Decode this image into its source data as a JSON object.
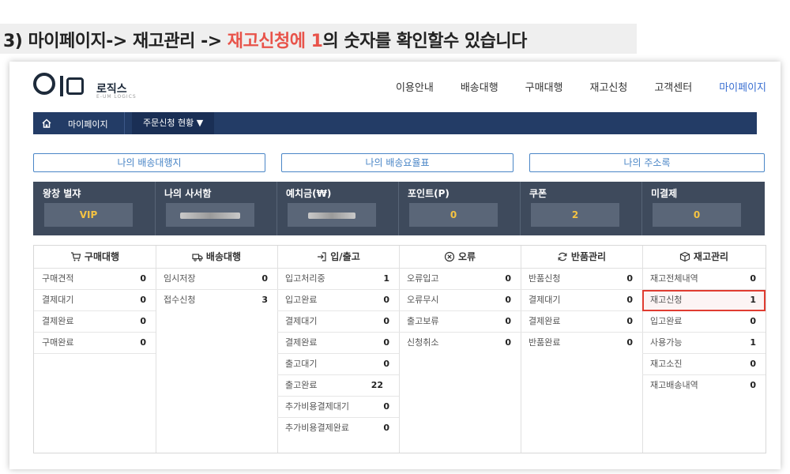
{
  "caption": {
    "part1": "3) 마이페이지-> 재고관리 -> ",
    "highlight": "재고신청에 1",
    "part2": "의 숫자를 확인할수 있습니다"
  },
  "logo": {
    "text": "로직스",
    "sub": "E-UM LOGICS"
  },
  "nav": [
    "이용안내",
    "배송대행",
    "구매대행",
    "재고신청",
    "고객센터",
    "마이페이지"
  ],
  "breadcrumb": {
    "mypage": "마이페이지",
    "dropdown": "주문신청 현황 ▼"
  },
  "quick_links": [
    "나의 배송대행지",
    "나의 배송요율표",
    "나의 주소록"
  ],
  "stats": [
    {
      "label": "왕창 벌쟈",
      "value": "VIP"
    },
    {
      "label": "나의 사서함",
      "value": ""
    },
    {
      "label": "예치금(₩)",
      "value": ""
    },
    {
      "label": "포인트(P)",
      "value": "0"
    },
    {
      "label": "쿠폰",
      "value": "2"
    },
    {
      "label": "미결제",
      "value": "0"
    }
  ],
  "columns": [
    {
      "title": "구매대행",
      "icon": "cart-icon",
      "rows": [
        {
          "label": "구매견적",
          "value": "0"
        },
        {
          "label": "결제대기",
          "value": "0"
        },
        {
          "label": "결제완료",
          "value": "0"
        },
        {
          "label": "구매완료",
          "value": "0"
        }
      ]
    },
    {
      "title": "배송대행",
      "icon": "truck-icon",
      "rows": [
        {
          "label": "임시저장",
          "value": "0"
        },
        {
          "label": "접수신청",
          "value": "3"
        }
      ]
    },
    {
      "title": "입/출고",
      "icon": "login-icon",
      "rows": [
        {
          "label": "입고처리중",
          "value": "1"
        },
        {
          "label": "입고완료",
          "value": "0"
        },
        {
          "label": "결제대기",
          "value": "0"
        },
        {
          "label": "결제완료",
          "value": "0"
        },
        {
          "label": "출고대기",
          "value": "0"
        },
        {
          "label": "출고완료",
          "value": "22"
        },
        {
          "label": "추가비용결제대기",
          "value": "0"
        },
        {
          "label": "추가비용결제완료",
          "value": "0"
        }
      ]
    },
    {
      "title": "오류",
      "icon": "error-circle-icon",
      "rows": [
        {
          "label": "오류입고",
          "value": "0"
        },
        {
          "label": "오류무시",
          "value": "0"
        },
        {
          "label": "출고보류",
          "value": "0"
        },
        {
          "label": "신청취소",
          "value": "0"
        }
      ]
    },
    {
      "title": "반품관리",
      "icon": "refresh-icon",
      "rows": [
        {
          "label": "반품신청",
          "value": "0"
        },
        {
          "label": "결제대기",
          "value": "0"
        },
        {
          "label": "결제완료",
          "value": "0"
        },
        {
          "label": "반품완료",
          "value": "0"
        }
      ]
    },
    {
      "title": "재고관리",
      "icon": "box-icon",
      "rows": [
        {
          "label": "재고전체내역",
          "value": "0"
        },
        {
          "label": "재고신청",
          "value": "1"
        },
        {
          "label": "입고완료",
          "value": "0"
        },
        {
          "label": "사용가능",
          "value": "1"
        },
        {
          "label": "재고소진",
          "value": "0"
        },
        {
          "label": "재고배송내역",
          "value": "0"
        }
      ]
    }
  ],
  "colors": {
    "highlight": "#e03c31",
    "nav_active": "#3a6fd1",
    "breadcrumb_bg": "#233c66",
    "stats_bg": "#3e4a5c",
    "stat_value": "#f5c342"
  }
}
